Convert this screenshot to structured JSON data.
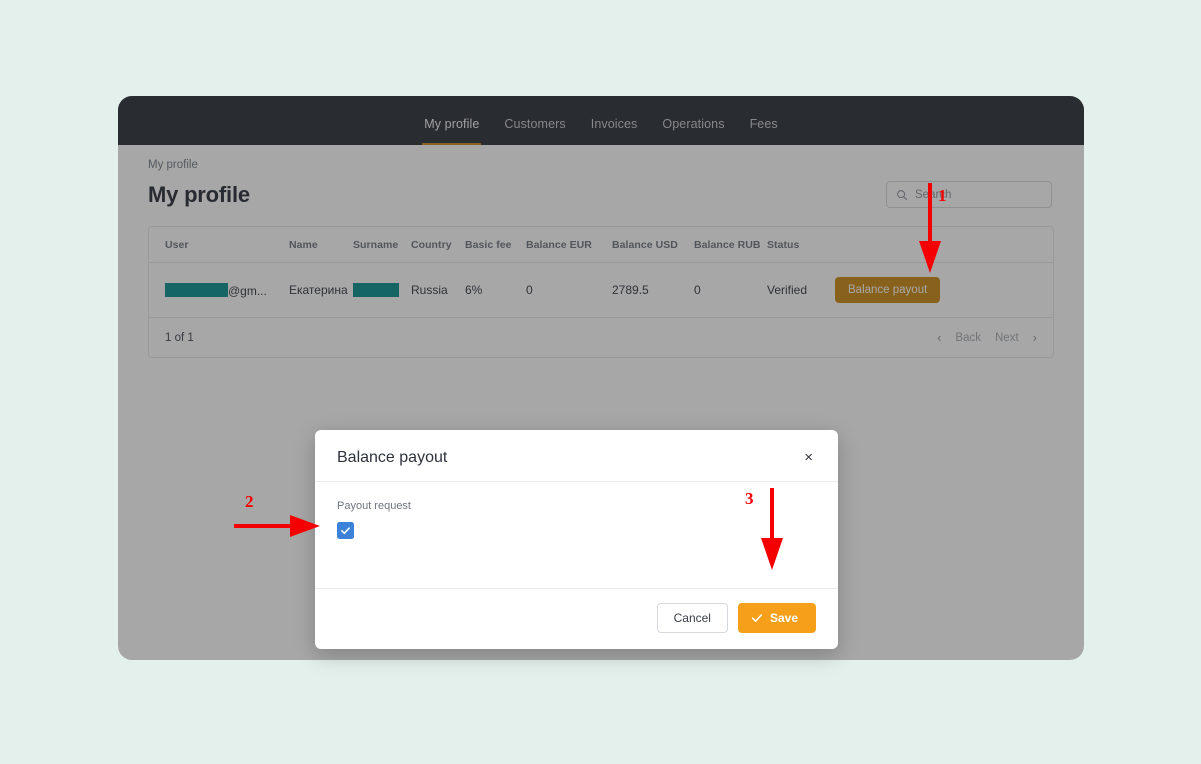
{
  "background_color": "#e4f0ec",
  "nav": {
    "items": [
      {
        "label": "My profile",
        "active": true
      },
      {
        "label": "Customers",
        "active": false
      },
      {
        "label": "Invoices",
        "active": false
      },
      {
        "label": "Operations",
        "active": false
      },
      {
        "label": "Fees",
        "active": false
      }
    ],
    "accent_color": "#c8860d",
    "bar_color": "#23272f"
  },
  "breadcrumb": "My profile",
  "page": {
    "title": "My profile"
  },
  "search": {
    "placeholder": "Search",
    "value": "",
    "icon": "search-icon"
  },
  "table": {
    "headers": [
      "User",
      "Name",
      "Surname",
      "Country",
      "Basic fee",
      "Balance EUR",
      "Balance USD",
      "Balance RUB",
      "Status",
      ""
    ],
    "rows": [
      {
        "user": "@gm...",
        "user_redacted": true,
        "name": "Екатерина",
        "surname": "",
        "surname_redacted": true,
        "country": "Russia",
        "basic_fee": "6%",
        "balance_eur": "0",
        "balance_usd": "2789.5",
        "balance_rub": "0",
        "status": "Verified",
        "action_label": "Balance payout"
      }
    ],
    "footer": {
      "count_label": "1 of 1",
      "prev_chevron": "‹",
      "back_label": "Back",
      "next_label": "Next",
      "next_chevron": "›"
    },
    "redaction_color": "#008b8b"
  },
  "modal": {
    "title": "Balance payout",
    "close_label": "×",
    "field_label": "Payout request",
    "checkbox_checked": true,
    "checkbox_color": "#3b82d8",
    "cancel_label": "Cancel",
    "save_label": "Save",
    "save_color": "#f59f1a"
  },
  "annotations": [
    {
      "number": "1",
      "type": "arrow-down",
      "color": "#f40000"
    },
    {
      "number": "2",
      "type": "arrow-right",
      "color": "#f40000"
    },
    {
      "number": "3",
      "type": "arrow-down",
      "color": "#f40000"
    }
  ]
}
